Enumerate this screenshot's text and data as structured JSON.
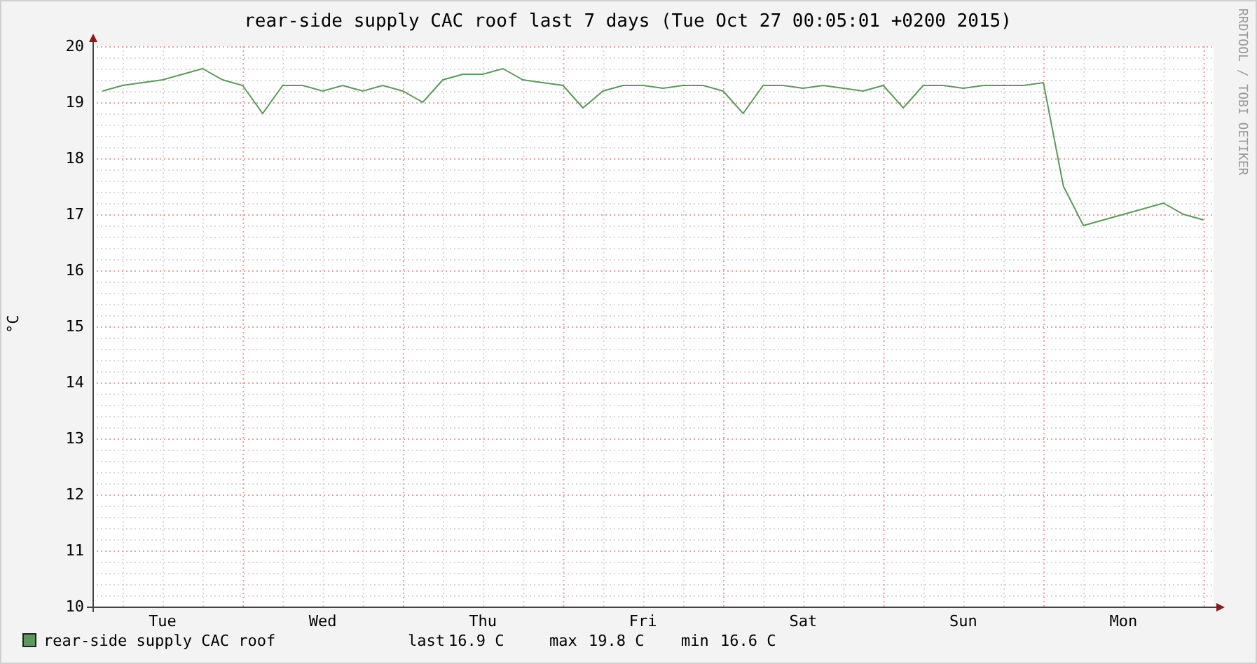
{
  "graph": {
    "credit": "RRDTOOL / TOBI OETIKER",
    "chart_data": {
      "type": "line",
      "title": "rear-side supply CAC roof last 7 days (Tue Oct 27 00:05:01 +0200 2015)",
      "ylabel": "°C",
      "categories": [
        null,
        null,
        null,
        "Tue",
        null,
        null,
        null,
        null,
        null,
        null,
        null,
        "Wed",
        null,
        null,
        null,
        null,
        null,
        null,
        null,
        "Thu",
        null,
        null,
        null,
        null,
        null,
        null,
        null,
        "Fri",
        null,
        null,
        null,
        null,
        null,
        null,
        null,
        "Sat",
        null,
        null,
        null,
        null,
        null,
        null,
        null,
        "Sun",
        null,
        null,
        null,
        null,
        null,
        null,
        null,
        "Mon",
        null,
        null,
        null,
        null
      ],
      "series": [
        {
          "name": "rear-side supply CAC roof",
          "color": "#5a9a5a",
          "values": [
            19.2,
            19.3,
            19.35,
            19.4,
            19.5,
            19.6,
            19.4,
            19.3,
            18.8,
            19.3,
            19.3,
            19.2,
            19.3,
            19.2,
            19.3,
            19.2,
            19.0,
            19.4,
            19.5,
            19.5,
            19.6,
            19.4,
            19.35,
            19.3,
            18.9,
            19.2,
            19.3,
            19.3,
            19.25,
            19.3,
            19.3,
            19.2,
            18.8,
            19.3,
            19.3,
            19.25,
            19.3,
            19.25,
            19.2,
            19.3,
            18.9,
            19.3,
            19.3,
            19.25,
            19.3,
            19.3,
            19.3,
            19.35,
            17.5,
            16.8,
            16.9,
            17.0,
            17.1,
            17.2,
            17.0,
            16.9
          ]
        }
      ],
      "ylim": [
        10,
        20
      ],
      "grid": true,
      "yticks": [
        10,
        11,
        12,
        13,
        14,
        15,
        16,
        17,
        18,
        19,
        20
      ]
    },
    "legend": {
      "stats": [
        {
          "label": "last",
          "value": "16.9 C"
        },
        {
          "label": "max",
          "value": "19.8 C"
        },
        {
          "label": "min",
          "value": "16.6 C"
        }
      ]
    }
  }
}
